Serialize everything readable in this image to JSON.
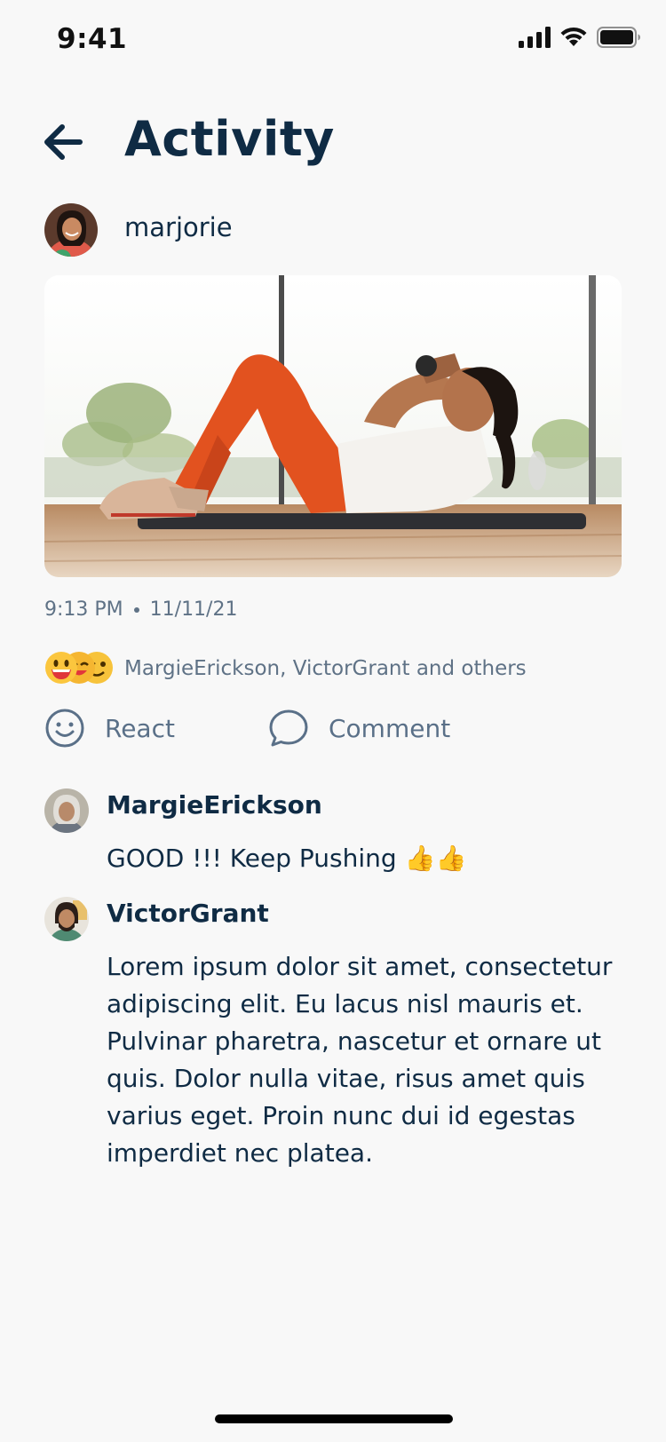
{
  "status_bar": {
    "time": "9:41",
    "icons": [
      "signal-icon",
      "wifi-icon",
      "battery-icon"
    ]
  },
  "header": {
    "title": "Activity",
    "back_icon": "arrow-left-icon"
  },
  "post": {
    "author": "marjorie",
    "time": "9:13 PM",
    "date": "11/11/21",
    "reactions_summary": "MargieErickson, VictorGrant and others",
    "reaction_emojis": [
      "grinning-face-icon",
      "face-with-tears-icon",
      "winking-face-icon"
    ]
  },
  "actions": {
    "react_label": "React",
    "comment_label": "Comment"
  },
  "comments": [
    {
      "author": "MargieErickson",
      "text": "GOOD !!! Keep Pushing 👍👍"
    },
    {
      "author": "VictorGrant",
      "text": "Lorem ipsum dolor sit amet, consectetur adipiscing elit. Eu lacus nisl mauris et. Pulvinar pharetra, nascetur et ornare ut quis. Dolor nulla vitae, risus amet quis varius eget. Proin nunc dui id egestas imperdiet nec platea."
    }
  ],
  "colors": {
    "primary_text": "#0f2b44",
    "secondary_text": "#5f7286",
    "background": "#f8f8f8"
  }
}
